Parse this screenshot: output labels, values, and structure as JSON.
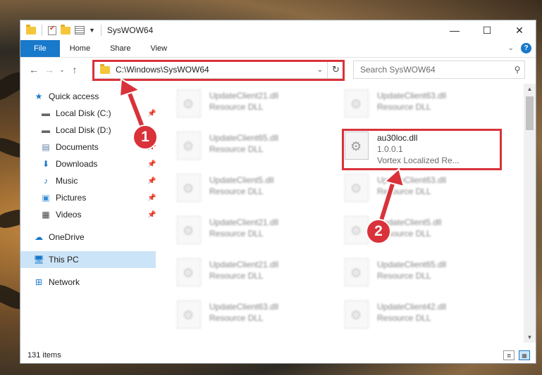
{
  "window": {
    "title": "SysWOW64"
  },
  "titlebar": {
    "minimize": "—",
    "maximize": "☐",
    "close": "✕"
  },
  "ribbon": {
    "tabs": [
      "File",
      "Home",
      "Share",
      "View"
    ],
    "help": "?"
  },
  "navigation": {
    "address": "C:\\Windows\\SysWOW64",
    "search_placeholder": "Search SysWOW64"
  },
  "sidebar": {
    "items": [
      {
        "label": "Quick access",
        "icon": "star-icon",
        "pinned": false
      },
      {
        "label": "Local Disk (C:)",
        "icon": "drive-icon",
        "pinned": true
      },
      {
        "label": "Local Disk (D:)",
        "icon": "drive-icon",
        "pinned": false
      },
      {
        "label": "Documents",
        "icon": "document-icon",
        "pinned": true
      },
      {
        "label": "Downloads",
        "icon": "download-icon",
        "pinned": true
      },
      {
        "label": "Music",
        "icon": "music-icon",
        "pinned": true
      },
      {
        "label": "Pictures",
        "icon": "picture-icon",
        "pinned": true
      },
      {
        "label": "Videos",
        "icon": "video-icon",
        "pinned": true
      },
      {
        "label": "OneDrive",
        "icon": "cloud-icon",
        "pinned": false
      },
      {
        "label": "This PC",
        "icon": "computer-icon",
        "pinned": false,
        "selected": true
      },
      {
        "label": "Network",
        "icon": "network-icon",
        "pinned": false
      }
    ]
  },
  "files": [
    {
      "name": "UpdateClient21.dll",
      "type": "Resource DLL"
    },
    {
      "name": "UpdateClient63.dll",
      "type": "Resource DLL"
    },
    {
      "name": "UpdateClient65.dll",
      "type": "Resource DLL"
    },
    {
      "name": "au30loc.dll",
      "version": "1.0.0.1",
      "type": "Vortex Localized Re..."
    },
    {
      "name": "UpdateClient5.dll",
      "type": "Resource DLL"
    },
    {
      "name": "UpdateClient63.dll",
      "type": "Resource DLL"
    },
    {
      "name": "UpdateClient21.dll",
      "type": "Resource DLL"
    },
    {
      "name": "UpdateClient5.dll",
      "type": "Resource DLL"
    },
    {
      "name": "UpdateClient21.dll",
      "type": "Resource DLL"
    },
    {
      "name": "UpdateClient65.dll",
      "type": "Resource DLL"
    },
    {
      "name": "UpdateClient63.dll",
      "type": "Resource DLL"
    },
    {
      "name": "UpdateClient42.dll",
      "type": "Resource DLL"
    }
  ],
  "status": {
    "item_count": "131 items"
  },
  "annotations": {
    "marker1": "1",
    "marker2": "2",
    "color": "#d9323a"
  }
}
